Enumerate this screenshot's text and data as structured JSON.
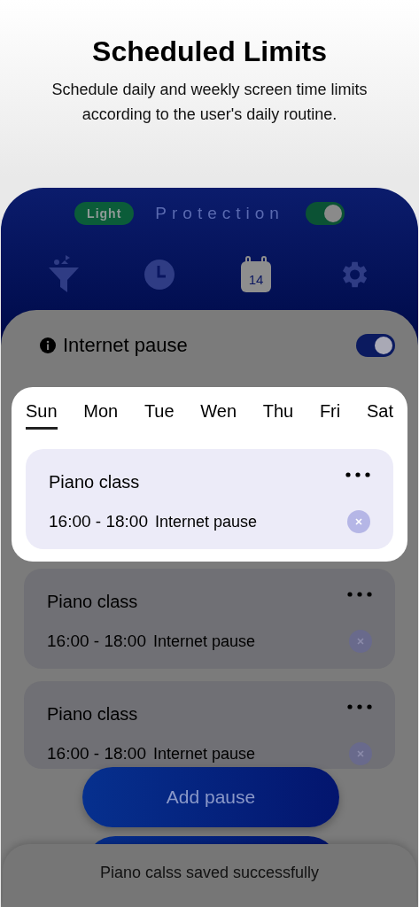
{
  "header": {
    "title": "Scheduled Limits",
    "subtitle": "Schedule daily and weekly screen time limits according to the user's daily routine."
  },
  "protection": {
    "mode": "Light",
    "label": "Protection",
    "on": true
  },
  "nav": [
    {
      "selected": false
    },
    {
      "selected": false
    },
    {
      "selected": true,
      "text": "14"
    },
    {
      "selected": false
    }
  ],
  "internet_pause": {
    "label": "Internet pause",
    "on": true
  },
  "days": [
    {
      "label": "Sun",
      "selected": true
    },
    {
      "label": "Mon",
      "selected": false
    },
    {
      "label": "Tue",
      "selected": false
    },
    {
      "label": "Wen",
      "selected": false
    },
    {
      "label": "Thu",
      "selected": false
    },
    {
      "label": "Fri",
      "selected": false
    },
    {
      "label": "Sat",
      "selected": false
    }
  ],
  "pauses": [
    {
      "title": "Piano class",
      "time": "16:00 - 18:00",
      "type": "Internet pause",
      "highlighted": true
    },
    {
      "title": "Piano class",
      "time": "16:00 - 18:00",
      "type": "Internet pause",
      "highlighted": false
    },
    {
      "title": "Piano class",
      "time": "16:00 - 18:00",
      "type": "Internet pause",
      "highlighted": false
    }
  ],
  "add_button": "Add pause",
  "toast": "Piano calss saved successfully"
}
